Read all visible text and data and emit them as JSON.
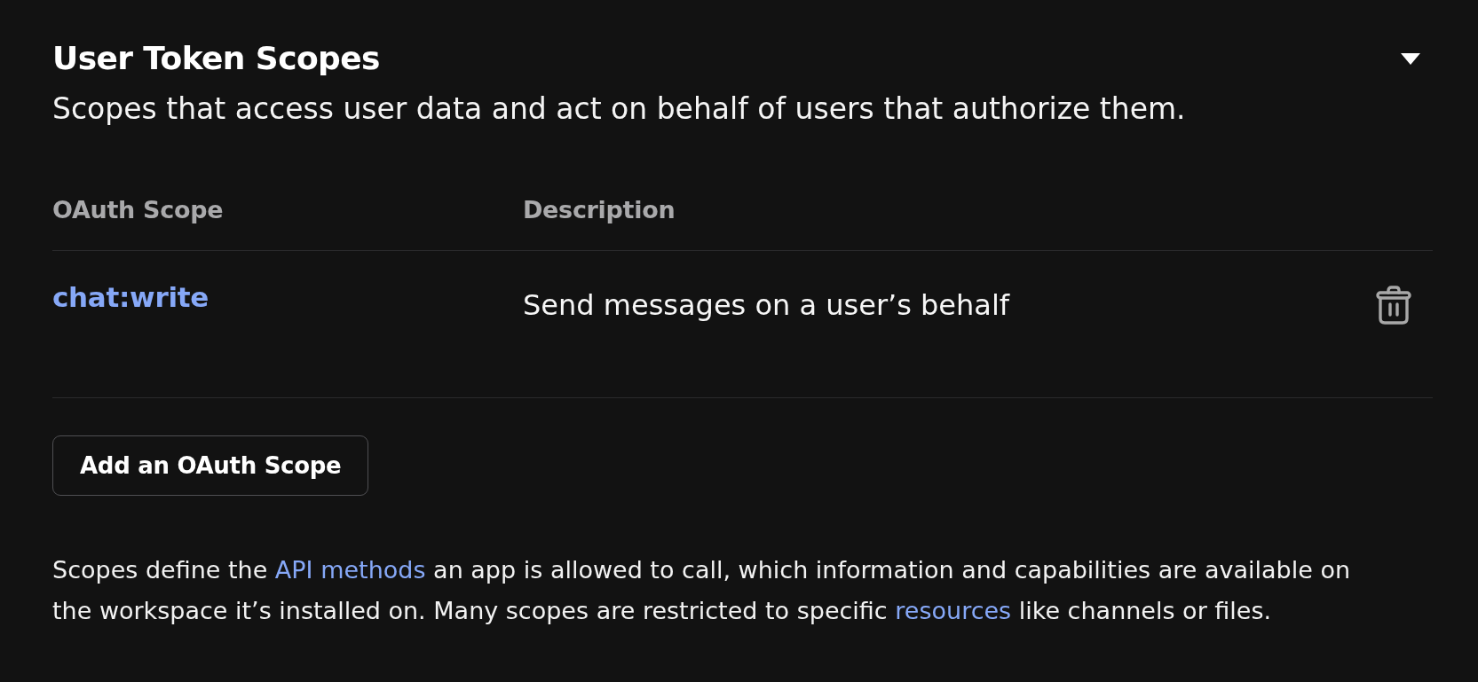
{
  "section": {
    "title": "User Token Scopes",
    "expanded": true,
    "subtitle": "Scopes that access user data and act on behalf of users that authorize them."
  },
  "table": {
    "columns": [
      "OAuth Scope",
      "Description"
    ],
    "rows": [
      {
        "scope": "chat:write",
        "description": "Send messages on a user’s behalf"
      }
    ]
  },
  "add_button": "Add an OAuth Scope",
  "footer": {
    "segments": [
      {
        "kind": "text",
        "text": "Scopes define the "
      },
      {
        "kind": "link",
        "text": "API methods"
      },
      {
        "kind": "text",
        "text": " an app is allowed to call, which information and capabilities are available on the workspace it’s installed on. Many scopes are restricted to specific "
      },
      {
        "kind": "link",
        "text": "resources"
      },
      {
        "kind": "text",
        "text": " like channels or files."
      }
    ]
  }
}
